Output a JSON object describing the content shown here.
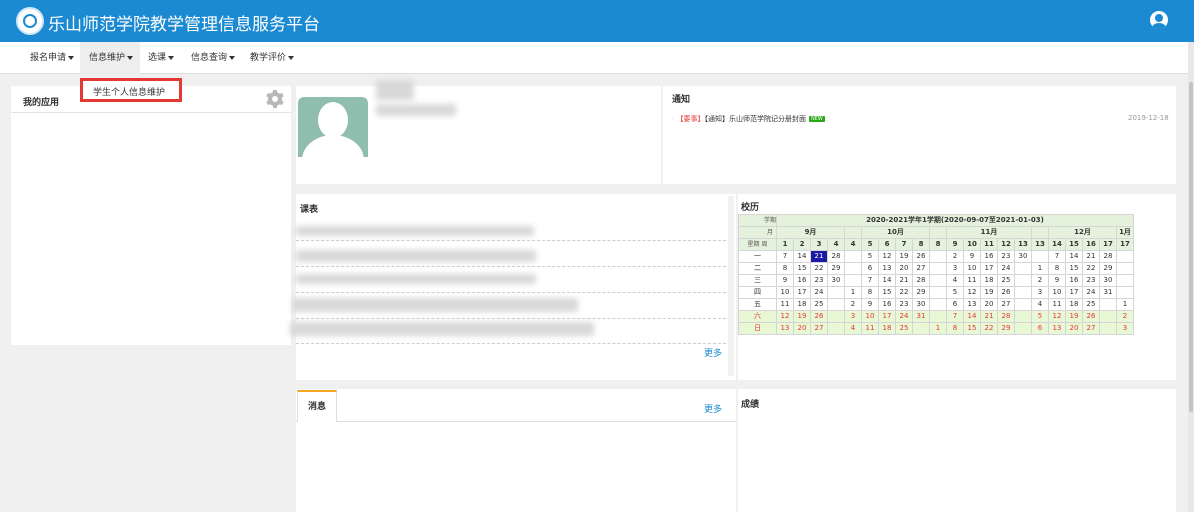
{
  "header": {
    "title": "乐山师范学院教学管理信息服务平台",
    "brand_color": "#1b8ad3"
  },
  "nav": {
    "items": [
      "报名申请",
      "信息维护",
      "选课",
      "信息查询",
      "教学评价"
    ]
  },
  "dropdown": {
    "item": "学生个人信息维护"
  },
  "my_apps": {
    "title": "我的应用"
  },
  "notice": {
    "title": "通知",
    "tag_important": "【要事】",
    "tag_notice": "【通知】",
    "text": "乐山师范学院记分册封面",
    "badge": "NEW",
    "date": "2019-12-18"
  },
  "schedule": {
    "title": "课表",
    "more": "更多"
  },
  "calendar": {
    "title": "校历",
    "semester": "2020-2021学年1学期(2020-09-07至2021-01-03)",
    "corner_labels": [
      "学期",
      "月",
      "周",
      "星期"
    ],
    "months": [
      "9月",
      "10月",
      "11月",
      "12月",
      "1月"
    ],
    "weeks": [
      "1",
      "2",
      "3",
      "4",
      "4",
      "5",
      "6",
      "7",
      "8",
      "8",
      "9",
      "10",
      "11",
      "12",
      "13",
      "13",
      "14",
      "15",
      "16",
      "17",
      "17"
    ],
    "days": [
      {
        "label": "一",
        "cells": [
          "7",
          "14",
          "21",
          "28",
          "",
          "5",
          "12",
          "19",
          "26",
          "",
          "2",
          "9",
          "16",
          "23",
          "30",
          "",
          "7",
          "14",
          "21",
          "28",
          ""
        ]
      },
      {
        "label": "二",
        "cells": [
          "8",
          "15",
          "22",
          "29",
          "",
          "6",
          "13",
          "20",
          "27",
          "",
          "3",
          "10",
          "17",
          "24",
          "",
          "1",
          "8",
          "15",
          "22",
          "29",
          ""
        ]
      },
      {
        "label": "三",
        "cells": [
          "9",
          "16",
          "23",
          "30",
          "",
          "7",
          "14",
          "21",
          "28",
          "",
          "4",
          "11",
          "18",
          "25",
          "",
          "2",
          "9",
          "16",
          "23",
          "30",
          ""
        ]
      },
      {
        "label": "四",
        "cells": [
          "10",
          "17",
          "24",
          "",
          "1",
          "8",
          "15",
          "22",
          "29",
          "",
          "5",
          "12",
          "19",
          "26",
          "",
          "3",
          "10",
          "17",
          "24",
          "31",
          ""
        ]
      },
      {
        "label": "五",
        "cells": [
          "11",
          "18",
          "25",
          "",
          "2",
          "9",
          "16",
          "23",
          "30",
          "",
          "6",
          "13",
          "20",
          "27",
          "",
          "4",
          "11",
          "18",
          "25",
          "",
          "1"
        ]
      },
      {
        "label": "六",
        "cells": [
          "12",
          "19",
          "26",
          "",
          "3",
          "10",
          "17",
          "24",
          "31",
          "",
          "7",
          "14",
          "21",
          "28",
          "",
          "5",
          "12",
          "19",
          "26",
          "",
          "2"
        ]
      },
      {
        "label": "日",
        "cells": [
          "13",
          "20",
          "27",
          "",
          "4",
          "11",
          "18",
          "25",
          "",
          "1",
          "8",
          "15",
          "22",
          "29",
          "",
          "6",
          "13",
          "20",
          "27",
          "",
          "3"
        ]
      }
    ],
    "today": "21"
  },
  "messages": {
    "tab": "消息",
    "more": "更多"
  },
  "grades": {
    "title": "成绩"
  }
}
